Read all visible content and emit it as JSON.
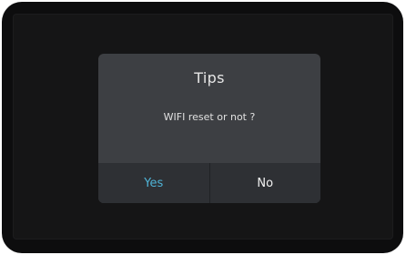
{
  "dialog": {
    "title": "Tips",
    "message": "WIFI reset or not ?",
    "yes_label": "Yes",
    "no_label": "No"
  },
  "colors": {
    "bezel": "#0d0d0e",
    "screen_background": "#151516",
    "dialog_background": "#3d3f43",
    "button_row_background": "#2e3034",
    "yes_accent": "#4fb3d6",
    "no_text": "#f2f2f2"
  }
}
